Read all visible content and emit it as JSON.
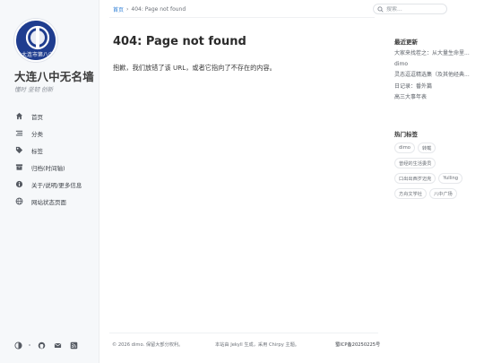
{
  "site": {
    "title": "大连八中无名墙",
    "subtitle": "懂时 坚韧 创新",
    "avatar_text": "大连市第八中"
  },
  "nav": [
    {
      "label": "首页",
      "icon": "home-icon"
    },
    {
      "label": "分类",
      "icon": "stream-icon"
    },
    {
      "label": "标签",
      "icon": "tags-icon"
    },
    {
      "label": "归档(时间轴)",
      "icon": "archive-icon"
    },
    {
      "label": "关于/说明/更多信息",
      "icon": "info-circle-icon"
    },
    {
      "label": "网站状态页面",
      "icon": "globe-icon"
    }
  ],
  "breadcrumb": {
    "home": "首页",
    "separator": "›",
    "current": "404: Page not found"
  },
  "search": {
    "placeholder": "搜索..."
  },
  "main": {
    "title": "404: Page not found",
    "message": "抱歉，我们放错了该 URL，或者它指向了不存在的内容。"
  },
  "recent": {
    "heading": "最近更新",
    "items": [
      "大家来找茬之：从大量生命里...",
      "dimo",
      "灵态逗逗精选集（及其他经典...",
      "日记录：番外篇",
      "高三大事年表"
    ]
  },
  "tags": {
    "heading": "热门标签",
    "items": [
      "dimo",
      "转载",
      "曾经的生活委员",
      "口出出西岁迈克",
      "Yulling",
      "方舟文学社",
      "八中广场"
    ]
  },
  "footer": {
    "copyright": "© 2026 dimo. 保留大部分权利。",
    "powered": "本站由 Jekyll 生成，采用 Chirpy 主题。",
    "icp": "蜀ICP备20250225号"
  },
  "colors": {
    "accent": "#2f7fd6",
    "avatar_bg": "#1f3d8f",
    "sidebar_bg": "#f6f8fa"
  }
}
